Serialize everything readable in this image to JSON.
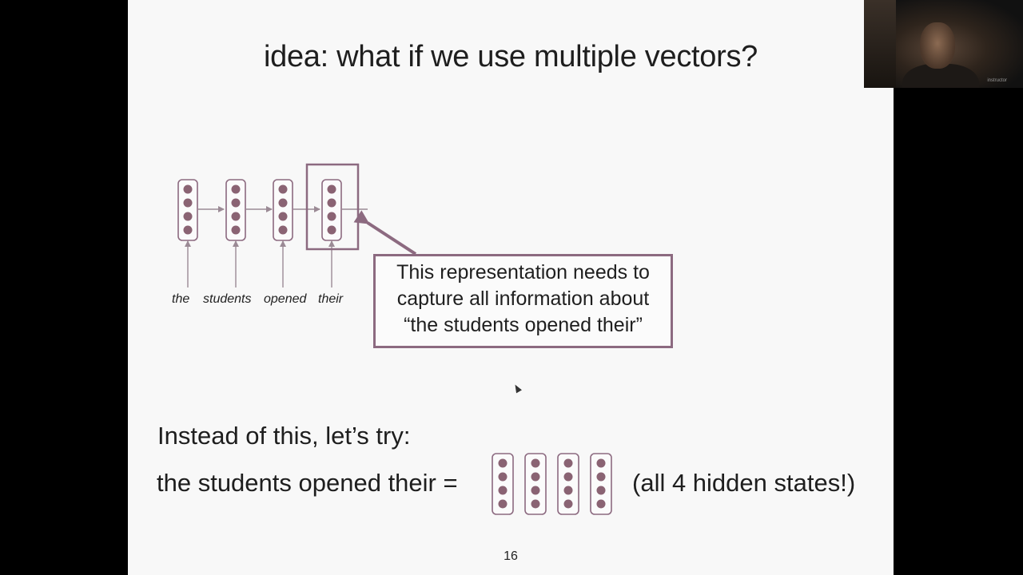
{
  "slide": {
    "title": "idea: what if we use multiple vectors?",
    "words": [
      "the",
      "students",
      "opened",
      "their"
    ],
    "callout_lines": [
      "This representation needs to",
      "capture all information about",
      "“the students opened their”"
    ],
    "instead_text": "Instead of this, let’s try:",
    "equation_lhs": "the students opened their =",
    "equation_note": "(all 4 hidden states!)",
    "page_number": "16"
  },
  "colors": {
    "node_fill": "#8a6373",
    "box_stroke": "#8c6a80",
    "slide_bg": "#f8f8f8"
  },
  "webcam": {
    "label": "instructor"
  }
}
